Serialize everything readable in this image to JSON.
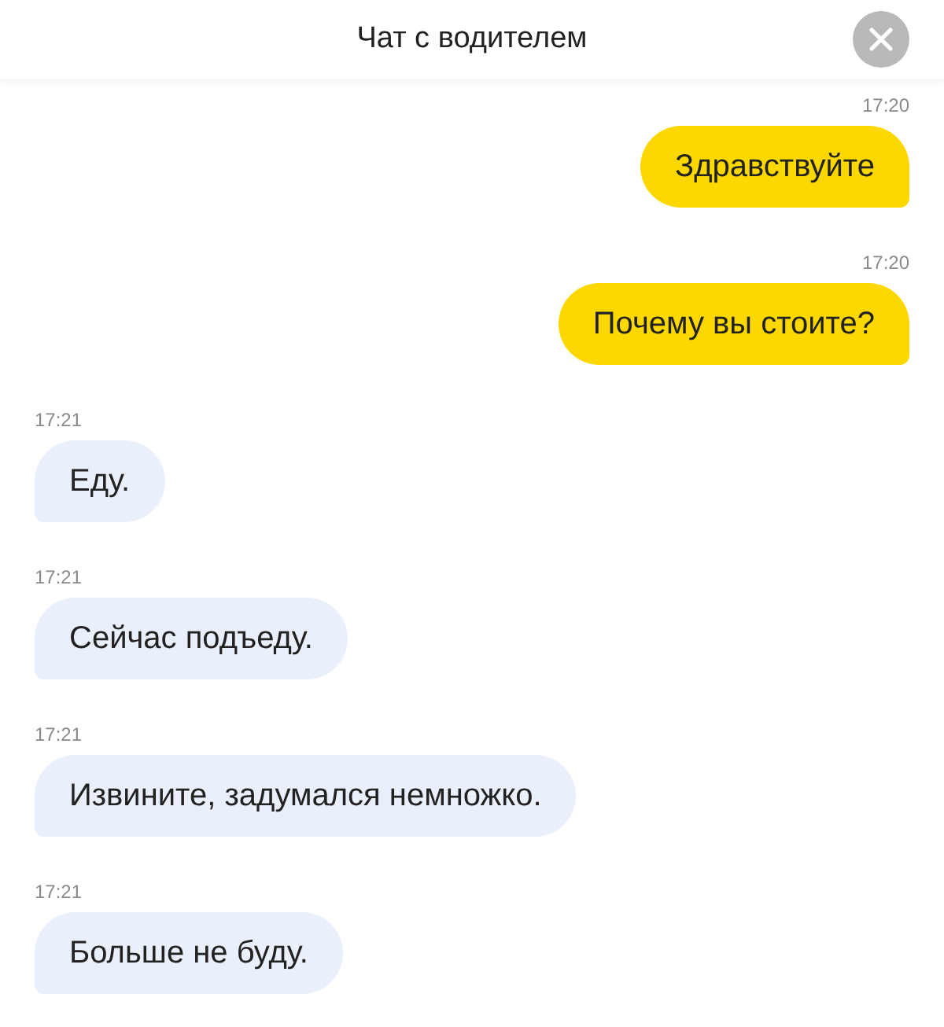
{
  "header": {
    "title": "Чат с водителем"
  },
  "messages": [
    {
      "time": "17:20",
      "text": "Здравствуйте",
      "kind": "outgoing"
    },
    {
      "time": "17:20",
      "text": "Почему вы стоите?",
      "kind": "outgoing"
    },
    {
      "time": "17:21",
      "text": "Еду.",
      "kind": "incoming"
    },
    {
      "time": "17:21",
      "text": "Сейчас подъеду.",
      "kind": "incoming"
    },
    {
      "time": "17:21",
      "text": "Извините, задумался немножко.",
      "kind": "incoming"
    },
    {
      "time": "17:21",
      "text": "Больше не буду.",
      "kind": "incoming"
    }
  ]
}
